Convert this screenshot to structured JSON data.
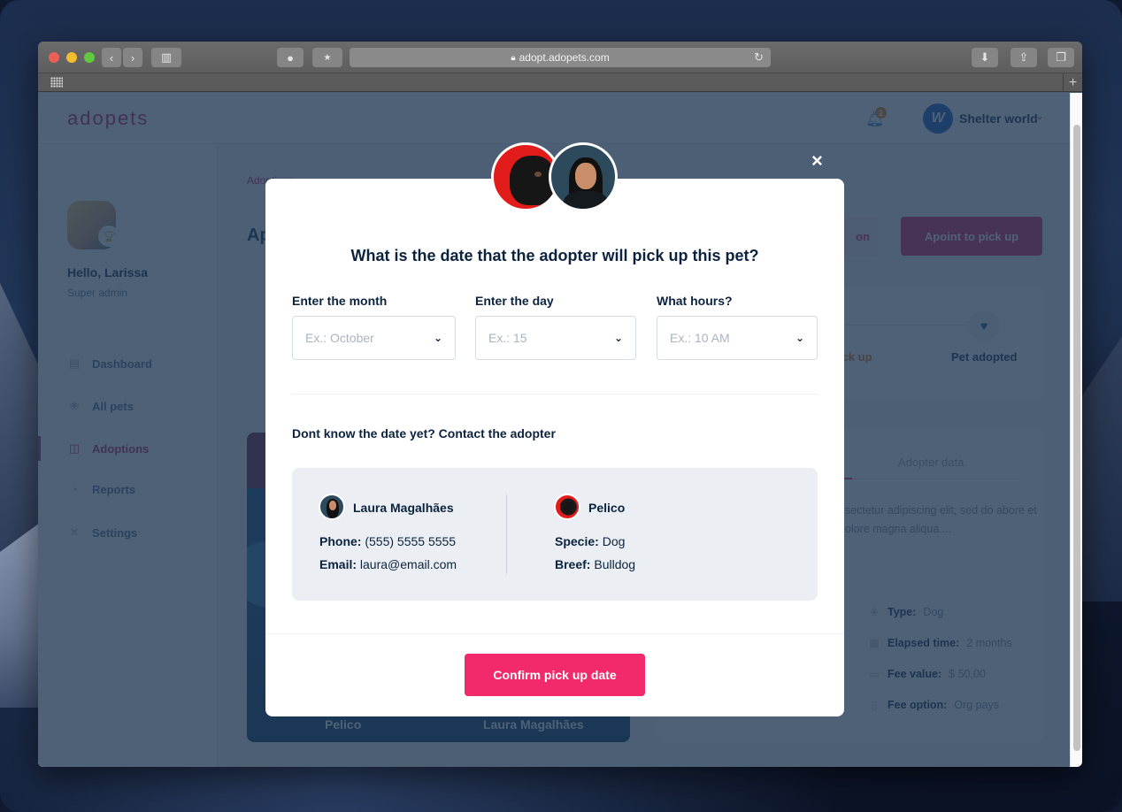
{
  "browser": {
    "url": "adopt.adopets.com",
    "lock_icon": "lock-icon",
    "reload_icon": "reload-icon",
    "new_tab_label": "+"
  },
  "app": {
    "logo": "adopets",
    "notifications_count": "2",
    "org_initial": "W",
    "org_name": "Shelter world"
  },
  "sidebar": {
    "greeting": "Hello, Larissa",
    "role": "Super admin",
    "items": [
      {
        "label": "Dashboard",
        "icon": "document-chart-icon",
        "active": false
      },
      {
        "label": "All pets",
        "icon": "paw-icon",
        "active": false
      },
      {
        "label": "Adoptions",
        "icon": "columns-icon",
        "active": true
      },
      {
        "label": "Reports",
        "icon": "pie-chart-icon",
        "active": false
      },
      {
        "label": "Settings",
        "icon": "tools-icon",
        "active": false
      }
    ]
  },
  "background_page": {
    "breadcrumb": "Adoptions",
    "title": "Ap",
    "secondary_button_fragment": "on",
    "primary_button": "Apoint to pick up",
    "progress_steps": [
      {
        "label": "ick up",
        "state": "current"
      },
      {
        "label": "Pet adopted",
        "state": "pending"
      }
    ],
    "pet_card": {
      "pet_name": "Pelico",
      "adopter_name": "Laura Magalhães"
    },
    "details_tab": "Adopter data",
    "description": "nsectetur adipiscing elit, sed do abore et dolore magna aliqua....",
    "specs": [
      {
        "label": "Type:",
        "value": "Dog",
        "icon": "paw-outline-icon"
      },
      {
        "label": "Elapsed time:",
        "value": "2 months",
        "icon": "calendar-icon"
      },
      {
        "label": "Fee value:",
        "value": "$ 50,00",
        "icon": "wallet-icon"
      },
      {
        "label": "Fee option:",
        "value": "Org pays",
        "icon": "receipt-icon"
      }
    ]
  },
  "modal": {
    "title": "What is the date that the adopter will pick up this pet?",
    "fields": [
      {
        "label": "Enter the month",
        "placeholder": "Ex.: October",
        "value": ""
      },
      {
        "label": "Enter the day",
        "placeholder": "Ex.: 15",
        "value": ""
      },
      {
        "label": "What hours?",
        "placeholder": "Ex.: 10 AM",
        "value": ""
      }
    ],
    "subtitle": "Dont know the date yet? Contact the adopter",
    "adopter": {
      "name": "Laura Magalhães",
      "phone_label": "Phone:",
      "phone": "(555) 5555 5555",
      "email_label": "Email:",
      "email": "laura@email.com"
    },
    "pet": {
      "name": "Pelico",
      "specie_label": "Specie:",
      "specie": "Dog",
      "breed_label": "Breef:",
      "breed": "Bulldog"
    },
    "confirm_label": "Confirm pick up date",
    "close_icon": "×"
  },
  "colors": {
    "brand": "#c3276f",
    "confirm": "#f2296b",
    "text_dark": "#0c2340",
    "overlay": "#1e3450"
  }
}
